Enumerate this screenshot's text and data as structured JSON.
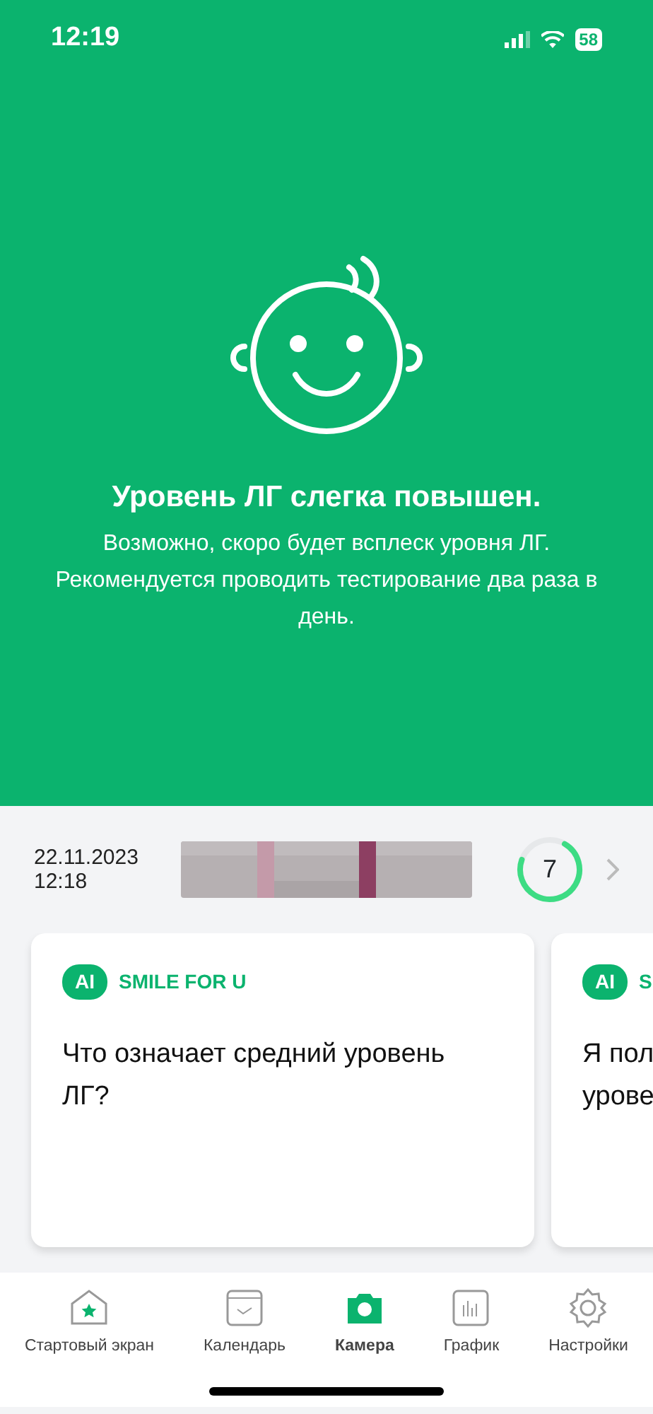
{
  "status_bar": {
    "time": "12:19",
    "battery": "58"
  },
  "hero": {
    "title": "Уровень ЛГ слегка повышен.",
    "text": "Возможно, скоро будет всплеск уровня ЛГ. Рекомендуется проводить тестирование два раза в день."
  },
  "result": {
    "date": "22.11.2023",
    "time": "12:18",
    "score": "7",
    "level": 0.72
  },
  "cards": [
    {
      "badge": "AI",
      "source": "SMILE FOR U",
      "question": "Что означает средний уровень ЛГ?"
    },
    {
      "badge": "AI",
      "source": "S",
      "question": "Я пол урове"
    }
  ],
  "tabs": [
    {
      "label": "Стартовый экран",
      "kind": "home",
      "selected": false
    },
    {
      "label": "Календарь",
      "kind": "calendar",
      "selected": false
    },
    {
      "label": "Камера",
      "kind": "camera",
      "selected": true
    },
    {
      "label": "График",
      "kind": "chart",
      "selected": false
    },
    {
      "label": "Настройки",
      "kind": "settings",
      "selected": false
    }
  ]
}
